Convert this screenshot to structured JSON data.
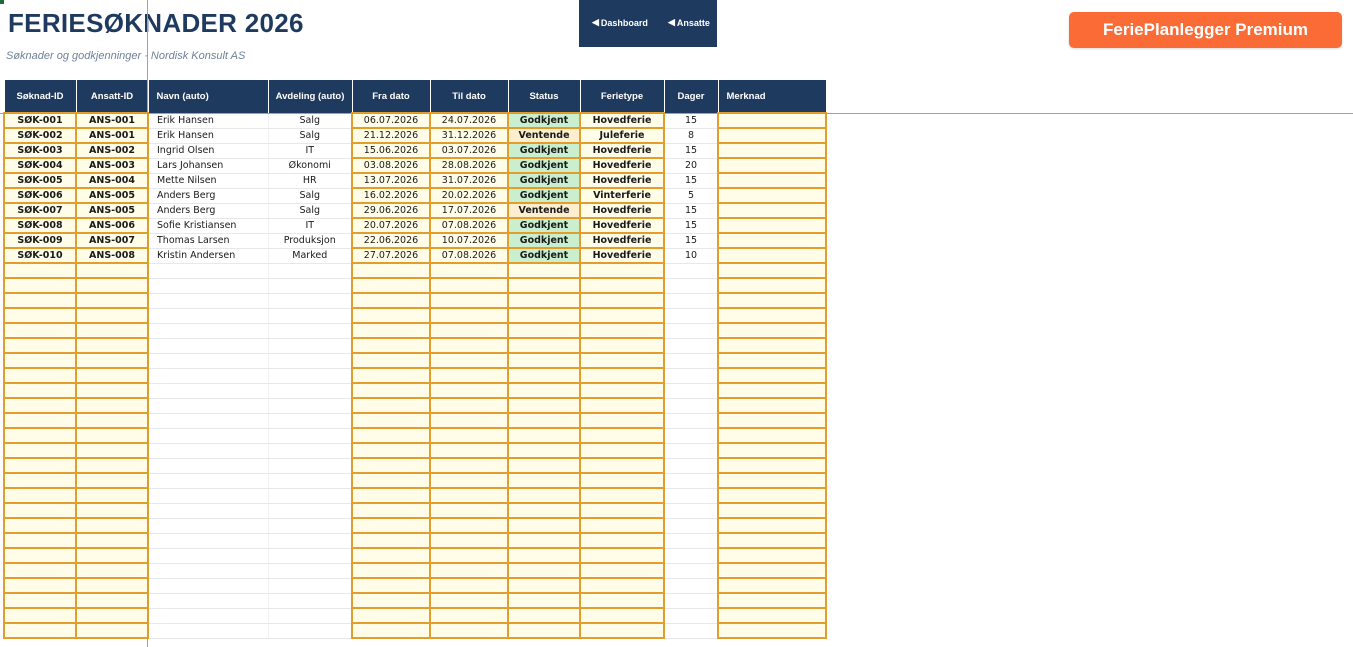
{
  "header": {
    "title": "FERIESØKNADER 2026",
    "subtitle": "Søknader og godkjenninger · Nordisk Konsult AS"
  },
  "nav": {
    "dashboard_label": "Dashboard",
    "ansatte_label": "Ansatte",
    "arrow_icon": "left-triangle-icon"
  },
  "premium_button": {
    "label": "FeriePlanlegger Premium",
    "color": "#fa6b35"
  },
  "colors": {
    "header_bg": "#1f3a5f",
    "input_border": "#e29d2d",
    "input_fill": "#fffde8",
    "status_approved": "#c9efcf",
    "status_pending": "#fdeecf"
  },
  "table": {
    "columns": [
      "Søknad-ID",
      "Ansatt-ID",
      "Navn (auto)",
      "Avdeling (auto)",
      "Fra dato",
      "Til dato",
      "Status",
      "Ferietype",
      "Dager",
      "Merknad"
    ],
    "rows": [
      {
        "id": "SØK-001",
        "ansatt": "ANS-001",
        "navn": "Erik Hansen",
        "avdeling": "Salg",
        "fra": "06.07.2026",
        "til": "24.07.2026",
        "status": "Godkjent",
        "type": "Hovedferie",
        "dager": "15",
        "merknad": ""
      },
      {
        "id": "SØK-002",
        "ansatt": "ANS-001",
        "navn": "Erik Hansen",
        "avdeling": "Salg",
        "fra": "21.12.2026",
        "til": "31.12.2026",
        "status": "Ventende",
        "type": "Juleferie",
        "dager": "8",
        "merknad": ""
      },
      {
        "id": "SØK-003",
        "ansatt": "ANS-002",
        "navn": "Ingrid Olsen",
        "avdeling": "IT",
        "fra": "15.06.2026",
        "til": "03.07.2026",
        "status": "Godkjent",
        "type": "Hovedferie",
        "dager": "15",
        "merknad": ""
      },
      {
        "id": "SØK-004",
        "ansatt": "ANS-003",
        "navn": "Lars Johansen",
        "avdeling": "Økonomi",
        "fra": "03.08.2026",
        "til": "28.08.2026",
        "status": "Godkjent",
        "type": "Hovedferie",
        "dager": "20",
        "merknad": ""
      },
      {
        "id": "SØK-005",
        "ansatt": "ANS-004",
        "navn": "Mette Nilsen",
        "avdeling": "HR",
        "fra": "13.07.2026",
        "til": "31.07.2026",
        "status": "Godkjent",
        "type": "Hovedferie",
        "dager": "15",
        "merknad": ""
      },
      {
        "id": "SØK-006",
        "ansatt": "ANS-005",
        "navn": "Anders Berg",
        "avdeling": "Salg",
        "fra": "16.02.2026",
        "til": "20.02.2026",
        "status": "Godkjent",
        "type": "Vinterferie",
        "dager": "5",
        "merknad": ""
      },
      {
        "id": "SØK-007",
        "ansatt": "ANS-005",
        "navn": "Anders Berg",
        "avdeling": "Salg",
        "fra": "29.06.2026",
        "til": "17.07.2026",
        "status": "Ventende",
        "type": "Hovedferie",
        "dager": "15",
        "merknad": ""
      },
      {
        "id": "SØK-008",
        "ansatt": "ANS-006",
        "navn": "Sofie Kristiansen",
        "avdeling": "IT",
        "fra": "20.07.2026",
        "til": "07.08.2026",
        "status": "Godkjent",
        "type": "Hovedferie",
        "dager": "15",
        "merknad": ""
      },
      {
        "id": "SØK-009",
        "ansatt": "ANS-007",
        "navn": "Thomas Larsen",
        "avdeling": "Produksjon",
        "fra": "22.06.2026",
        "til": "10.07.2026",
        "status": "Godkjent",
        "type": "Hovedferie",
        "dager": "15",
        "merknad": ""
      },
      {
        "id": "SØK-010",
        "ansatt": "ANS-008",
        "navn": "Kristin Andersen",
        "avdeling": "Marked",
        "fra": "27.07.2026",
        "til": "07.08.2026",
        "status": "Godkjent",
        "type": "Hovedferie",
        "dager": "10",
        "merknad": ""
      }
    ]
  }
}
